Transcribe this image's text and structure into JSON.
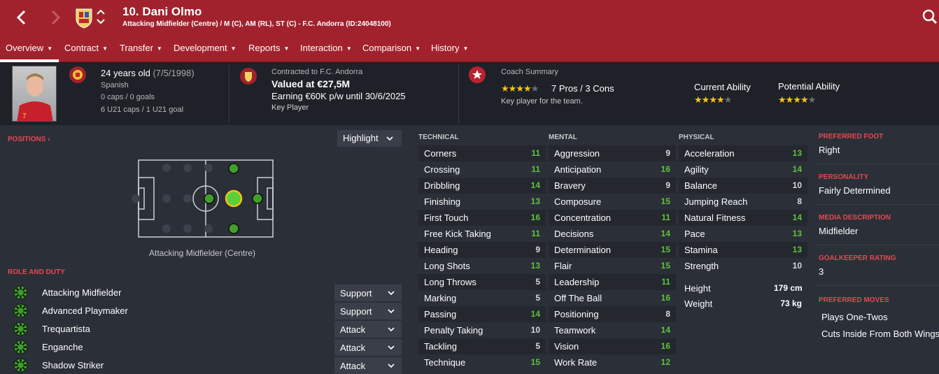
{
  "header": {
    "name": "10. Dani Olmo",
    "subtitle": "Attacking Midfielder (Centre) / M (C), AM (RL), ST (C) - F.C. Andorra (ID:24048100)"
  },
  "tabs": [
    {
      "label": "Overview"
    },
    {
      "label": "Contract"
    },
    {
      "label": "Transfer"
    },
    {
      "label": "Development"
    },
    {
      "label": "Reports"
    },
    {
      "label": "Interaction"
    },
    {
      "label": "Comparison"
    },
    {
      "label": "History"
    }
  ],
  "summary": {
    "age": "24 years old",
    "dob": "(7/5/1998)",
    "nationality": "Spanish",
    "caps": "0 caps / 0 goals",
    "u21": "6 U21 caps / 1 U21 goal",
    "contract_to": "Contracted to F.C. Andorra",
    "value": "Valued at €27,5M",
    "earning": "Earning €60K p/w until 30/6/2025",
    "status": "Key Player",
    "coach_title": "Coach Summary",
    "coach_rating": 4,
    "pros_cons": "7 Pros / 3 Cons",
    "coach_note": "Key player for the team.",
    "ca_label": "Current Ability",
    "ca_stars": 4,
    "pa_label": "Potential Ability",
    "pa_stars": 4
  },
  "positions": {
    "label": "POSITIONS",
    "highlight": "Highlight",
    "caption": "Attacking Midfielder (Centre)"
  },
  "roles": {
    "label": "ROLE AND DUTY",
    "items": [
      {
        "name": "Attacking Midfielder",
        "duty": "Support"
      },
      {
        "name": "Advanced Playmaker",
        "duty": "Support"
      },
      {
        "name": "Trequartista",
        "duty": "Attack"
      },
      {
        "name": "Enganche",
        "duty": "Attack"
      },
      {
        "name": "Shadow Striker",
        "duty": "Attack"
      }
    ]
  },
  "technical": {
    "title": "TECHNICAL",
    "items": [
      {
        "name": "Corners",
        "value": "11"
      },
      {
        "name": "Crossing",
        "value": "11"
      },
      {
        "name": "Dribbling",
        "value": "14"
      },
      {
        "name": "Finishing",
        "value": "13"
      },
      {
        "name": "First Touch",
        "value": "16"
      },
      {
        "name": "Free Kick Taking",
        "value": "11"
      },
      {
        "name": "Heading",
        "value": "9"
      },
      {
        "name": "Long Shots",
        "value": "13"
      },
      {
        "name": "Long Throws",
        "value": "5"
      },
      {
        "name": "Marking",
        "value": "5"
      },
      {
        "name": "Passing",
        "value": "14"
      },
      {
        "name": "Penalty Taking",
        "value": "10"
      },
      {
        "name": "Tackling",
        "value": "5"
      },
      {
        "name": "Technique",
        "value": "15"
      }
    ]
  },
  "mental": {
    "title": "MENTAL",
    "items": [
      {
        "name": "Aggression",
        "value": "9"
      },
      {
        "name": "Anticipation",
        "value": "16"
      },
      {
        "name": "Bravery",
        "value": "9"
      },
      {
        "name": "Composure",
        "value": "15"
      },
      {
        "name": "Concentration",
        "value": "11"
      },
      {
        "name": "Decisions",
        "value": "14"
      },
      {
        "name": "Determination",
        "value": "15"
      },
      {
        "name": "Flair",
        "value": "15"
      },
      {
        "name": "Leadership",
        "value": "11"
      },
      {
        "name": "Off The Ball",
        "value": "16"
      },
      {
        "name": "Positioning",
        "value": "8"
      },
      {
        "name": "Teamwork",
        "value": "14"
      },
      {
        "name": "Vision",
        "value": "16"
      },
      {
        "name": "Work Rate",
        "value": "12"
      }
    ]
  },
  "physical": {
    "title": "PHYSICAL",
    "items": [
      {
        "name": "Acceleration",
        "value": "13"
      },
      {
        "name": "Agility",
        "value": "14"
      },
      {
        "name": "Balance",
        "value": "10"
      },
      {
        "name": "Jumping Reach",
        "value": "8"
      },
      {
        "name": "Natural Fitness",
        "value": "14"
      },
      {
        "name": "Pace",
        "value": "13"
      },
      {
        "name": "Stamina",
        "value": "13"
      },
      {
        "name": "Strength",
        "value": "10"
      }
    ],
    "height_label": "Height",
    "height": "179 cm",
    "weight_label": "Weight",
    "weight": "73 kg"
  },
  "info": {
    "foot_label": "PREFERRED FOOT",
    "foot": "Right",
    "personality_label": "PERSONALITY",
    "personality": "Fairly Determined",
    "media_label": "MEDIA DESCRIPTION",
    "media": "Midfielder",
    "gk_label": "GOALKEEPER RATING",
    "gk": "3",
    "moves_label": "PREFERRED MOVES",
    "moves": [
      "Plays One-Twos",
      "Cuts Inside From Both Wings"
    ]
  },
  "colors": {
    "header": "#a1222d",
    "bg": "#2b2f38",
    "green": "#5cc43a",
    "red_label": "#e7484f",
    "star": "#f5c518"
  }
}
